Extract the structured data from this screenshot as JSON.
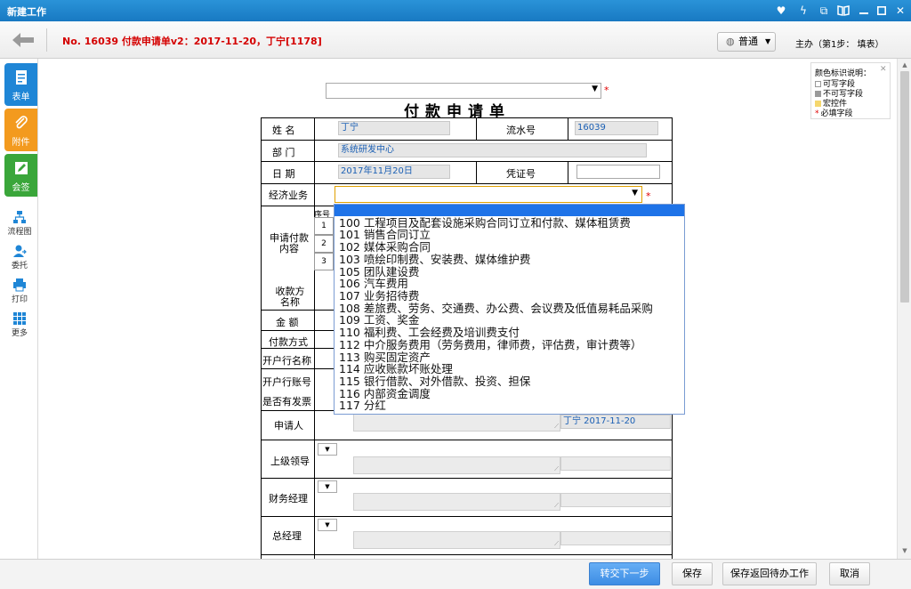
{
  "window": {
    "title": "新建工作",
    "controls": [
      "heart-icon",
      "bolt-icon",
      "new-window-icon",
      "book-icon",
      "minimize-icon",
      "maximize-icon",
      "close-icon"
    ]
  },
  "header": {
    "doc_title": "No. 16039 付款申请单v2：2017-11-20，丁宁[1178]",
    "view_mode": "普通",
    "step_info": "主办（第1步： 填表）"
  },
  "sidebar": {
    "tabs": [
      {
        "label": "表单",
        "icon": "form-icon",
        "color": "#1f86d6"
      },
      {
        "label": "附件",
        "icon": "paperclip-icon",
        "color": "#f39a1e"
      },
      {
        "label": "会签",
        "icon": "edit-icon",
        "color": "#3aa63a"
      }
    ],
    "items": [
      {
        "label": "流程图",
        "icon": "flowchart-icon"
      },
      {
        "label": "委托",
        "icon": "delegate-icon"
      },
      {
        "label": "打印",
        "icon": "print-icon"
      },
      {
        "label": "更多",
        "icon": "more-grid-icon"
      }
    ]
  },
  "legend": {
    "title": "颜色标识说明：",
    "rows": [
      {
        "label": "可写字段",
        "color": "#ffffff"
      },
      {
        "label": "不可写字段",
        "color": "#9a9a9a"
      },
      {
        "label": "宏控件",
        "color": "#f5d76e"
      },
      {
        "label": "必填字段",
        "mark": "*"
      }
    ]
  },
  "form": {
    "title": "付款申请单",
    "top_select_value": "",
    "name_label": "姓 名",
    "name_value": "丁宁",
    "serial_label": "流水号",
    "serial_value": "16039",
    "dept_label": "部 门",
    "dept_value": "系统研发中心",
    "date_label": "日 期",
    "date_value": "2017年11月20日",
    "invoice_label": "凭证号",
    "invoice_value": "",
    "business_label": "经济业务",
    "business_value": "",
    "content_label": "申请付款内容",
    "seq_header": "序号",
    "seq_rows": [
      "1",
      "2",
      "3"
    ],
    "payee_label": "收款方名称",
    "amount_label": "金 额",
    "pay_method_label": "付款方式",
    "bank_name_label": "开户行名称",
    "bank_account_label": "开户行账号",
    "has_invoice_label": "是否有发票",
    "applicant_label": "申请人",
    "applicant_sign": "丁宁 2017-11-20",
    "superior_label": "上级领导",
    "finance_label": "财务经理",
    "gm_label": "总经理"
  },
  "dropdown": {
    "options": [
      "100 工程项目及配套设施采购合同订立和付款、媒体租赁费",
      "101 销售合同订立",
      "102 媒体采购合同",
      "103 喷绘印制费、安装费、媒体维护费",
      "105 团队建设费",
      "106 汽车费用",
      "107 业务招待费",
      "108 差旅费、劳务、交通费、办公费、会议费及低值易耗品采购",
      "109 工资、奖金",
      "110 福利费、工会经费及培训费支付",
      "112 中介服务费用（劳务费用，律师费，评估费，审计费等）",
      "113 购买固定资产",
      "114 应收账款坏账处理",
      "115 银行借款、对外借款、投资、担保",
      "116 内部资金调度",
      "117 分红"
    ]
  },
  "footer": {
    "submit_label": "转交下一步",
    "save_label": "保存",
    "save_return_label": "保存返回待办工作",
    "cancel_label": "取消"
  }
}
